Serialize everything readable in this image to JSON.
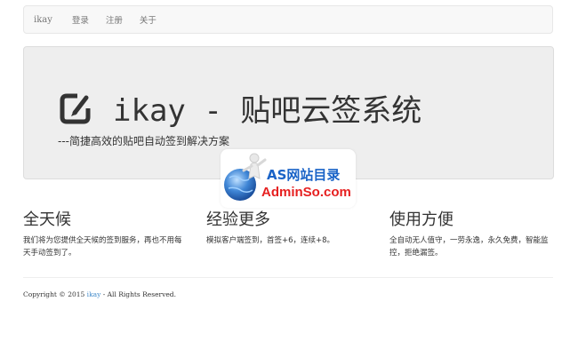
{
  "navbar": {
    "brand": "ikay",
    "items": [
      {
        "label": "登录"
      },
      {
        "label": "注册"
      },
      {
        "label": "关于"
      }
    ]
  },
  "hero": {
    "icon": "edit-square-icon",
    "title": "ikay - 贴吧云签系统",
    "subtitle": "---简捷高效的贴吧自动签到解决方案"
  },
  "watermark": {
    "text_top": "AS网站目录",
    "text_bottom": "AdminSo.com",
    "colors": {
      "blue": "#1a63c7",
      "red": "#e62020"
    }
  },
  "features": [
    {
      "title": "全天候",
      "desc": "我们将为您提供全天候的签到服务，再也不用每天手动签到了。"
    },
    {
      "title": "经验更多",
      "desc": "模拟客户端签到，首签+6，连续+8。"
    },
    {
      "title": "使用方便",
      "desc": "全自动无人值守，一劳永逸，永久免费，智能监控，拒绝漏签。"
    }
  ],
  "footer": {
    "prefix": "Copyright © 2015 ",
    "link": "ikay",
    "suffix": " - All Rights Reserved."
  }
}
